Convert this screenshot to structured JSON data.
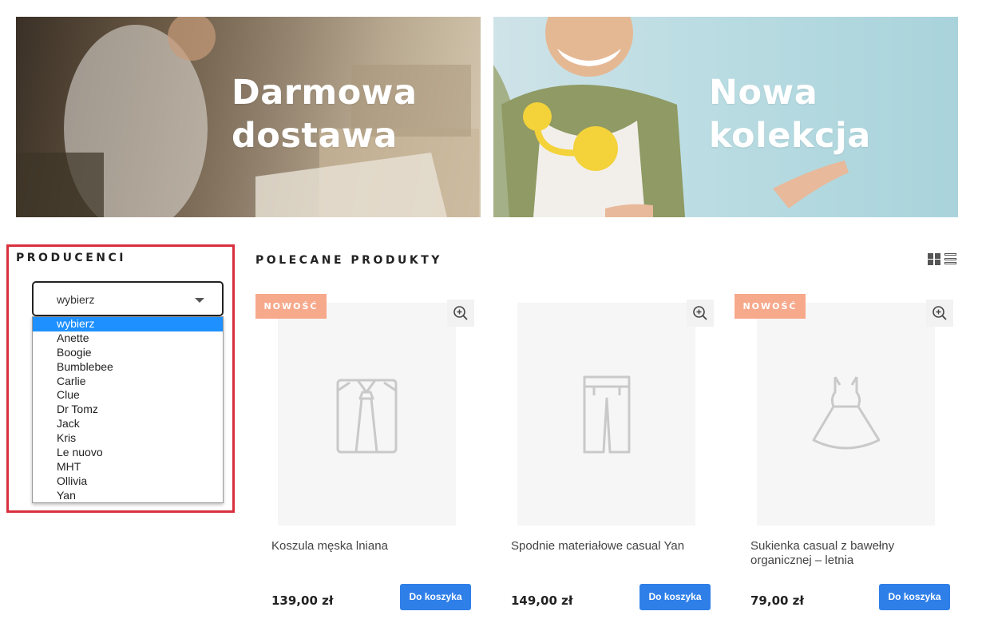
{
  "banners": [
    {
      "line1": "Darmowa",
      "line2": "dostawa"
    },
    {
      "line1": "Nowa",
      "line2": "kolekcja"
    }
  ],
  "producers": {
    "title": "PRODUCENCI",
    "select_value": "wybierz",
    "options": [
      "wybierz",
      "Anette",
      "Boogie",
      "Bumblebee",
      "Carlie",
      "Clue",
      "Dr Tomz",
      "Jack",
      "Kris",
      "Le nuovo",
      "MHT",
      "Ollivia",
      "Yan"
    ]
  },
  "featured": {
    "title": "POLECANE PRODUKTY",
    "products": [
      {
        "badge": "NOWOŚĆ",
        "name": "Koszula męska lniana",
        "price": "139,00 zł",
        "cart_label": "Do koszyka",
        "icon": "shirt-icon"
      },
      {
        "badge": "",
        "name": "Spodnie materiałowe casual Yan",
        "price": "149,00 zł",
        "cart_label": "Do koszyka",
        "icon": "trousers-icon"
      },
      {
        "badge": "NOWOŚĆ",
        "name": "Sukienka casual z bawełny organicznej – letnia",
        "price": "79,00 zł",
        "cart_label": "Do koszyka",
        "icon": "dress-icon"
      }
    ]
  },
  "colors": {
    "accent": "#2f7fe8",
    "badge": "#f7a98c",
    "highlight": "#d9303e",
    "selected": "#1e90ff"
  }
}
